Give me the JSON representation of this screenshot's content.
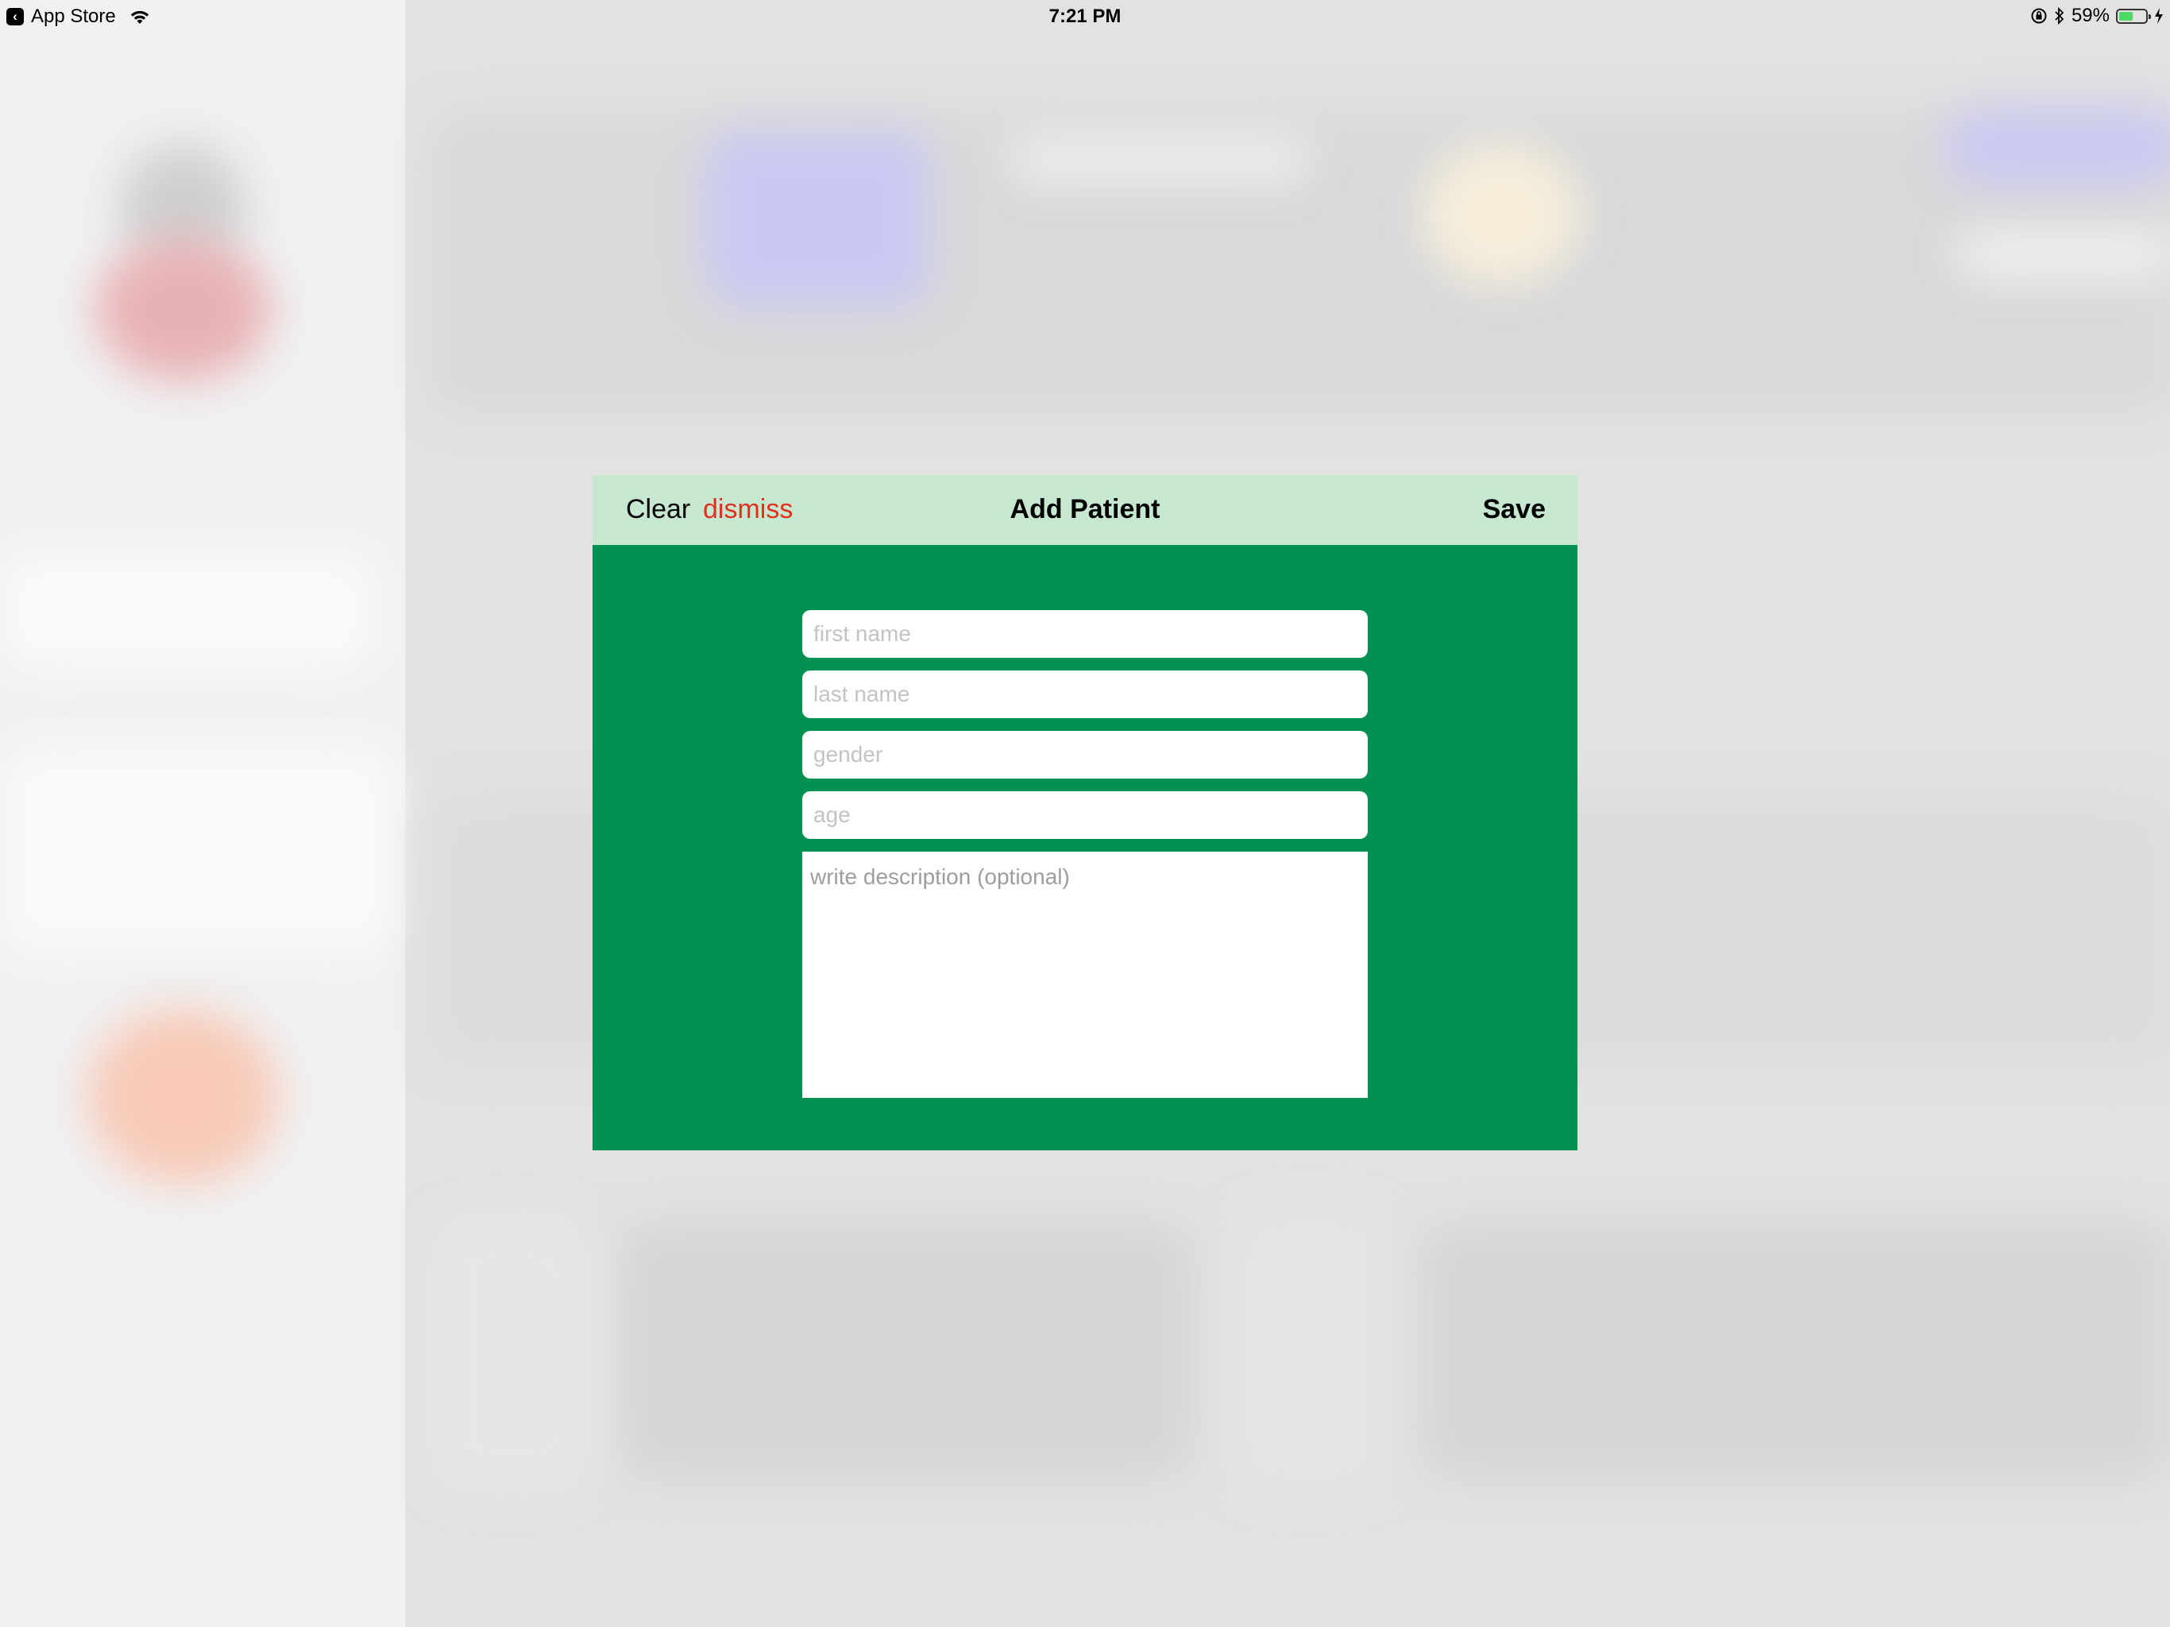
{
  "status_bar": {
    "back_app": "App Store",
    "time": "7:21 PM",
    "battery": "59%",
    "battery_level": 0.59
  },
  "modal": {
    "title": "Add Patient",
    "clear_label": "Clear",
    "dismiss_label": "dismiss",
    "save_label": "Save",
    "fields": {
      "first_name_placeholder": "first name",
      "last_name_placeholder": "last name",
      "gender_placeholder": "gender",
      "age_placeholder": "age",
      "description_placeholder": "write description (optional)"
    }
  },
  "colors": {
    "modal_background": "#009051",
    "nav_background": "#c7e8d0",
    "dismiss": "#e0301e",
    "battery_fill": "#4cd964"
  },
  "icons": {
    "back": "back-arrow-icon",
    "wifi": "wifi-icon",
    "orientation_lock": "orientation-lock-icon",
    "bluetooth": "bluetooth-icon",
    "battery": "battery-icon",
    "charging": "charging-bolt-icon"
  }
}
